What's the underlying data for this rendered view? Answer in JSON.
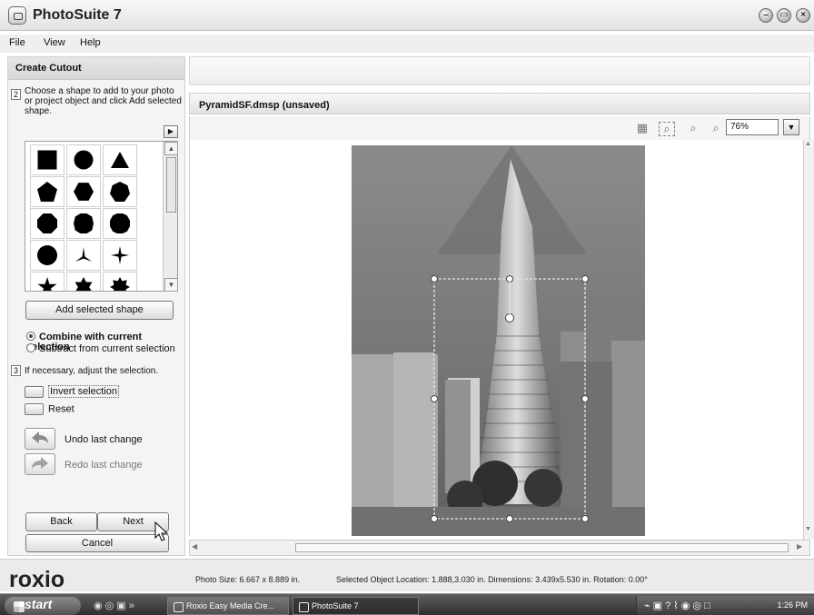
{
  "window": {
    "title": "PhotoSuite 7"
  },
  "menu": [
    "File",
    "View",
    "Help"
  ],
  "panel": {
    "title": "Create Cutout",
    "step2_num": "2",
    "step2_text": [
      "Choose a shape to add to your photo",
      "or project object and click Add selected",
      "shape."
    ],
    "add_shape_label": "Add selected shape",
    "combine_label": "Combine with current selection",
    "subtract_label": "Subtract from current selection",
    "step3_num": "3",
    "step3_text": "If necessary, adjust the selection.",
    "invert_label": "Invert selection",
    "reset_label": "Reset",
    "undo_label": "Undo last change",
    "redo_label": "Redo last change",
    "back_label": "Back",
    "next_label": "Next",
    "cancel_label": "Cancel"
  },
  "document": {
    "title": "PyramidSF.dmsp (unsaved)",
    "zoom": "76%"
  },
  "status": {
    "brand": "roxio",
    "photo_size": "Photo Size: 6.667 x 8.889 in.",
    "selection": "Selected Object Location: 1.888,3.030 in. Dimensions: 3.439x5.530 in. Rotation: 0.00°"
  },
  "taskbar": {
    "start": "start",
    "tasks": [
      "Roxio Easy Media Cre...",
      "PhotoSuite 7"
    ],
    "clock": "1:26 PM"
  }
}
